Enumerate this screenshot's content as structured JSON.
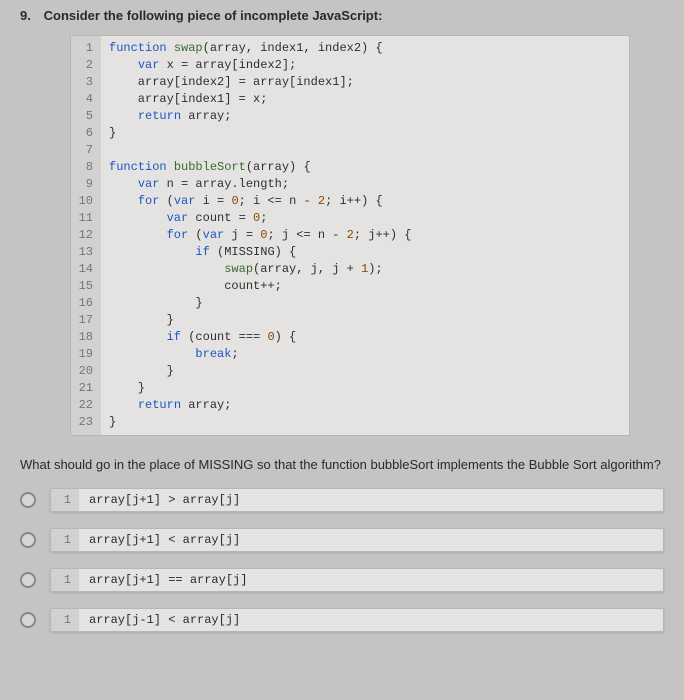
{
  "question": {
    "number": "9.",
    "text": "Consider the following piece of incomplete JavaScript:"
  },
  "code": {
    "lineNumbers": [
      "1",
      "2",
      "3",
      "4",
      "5",
      "6",
      "7",
      "8",
      "9",
      "10",
      "11",
      "12",
      "13",
      "14",
      "15",
      "16",
      "17",
      "18",
      "19",
      "20",
      "21",
      "22",
      "23"
    ],
    "lines": [
      "function swap(array, index1, index2) {",
      "    var x = array[index2];",
      "    array[index2] = array[index1];",
      "    array[index1] = x;",
      "    return array;",
      "}",
      "",
      "function bubbleSort(array) {",
      "    var n = array.length;",
      "    for (var i = 0; i <= n - 2; i++) {",
      "        var count = 0;",
      "        for (var j = 0; j <= n - 2; j++) {",
      "            if (MISSING) {",
      "                swap(array, j, j + 1);",
      "                count++;",
      "            }",
      "        }",
      "        if (count === 0) {",
      "            break;",
      "        }",
      "    }",
      "    return array;",
      "}"
    ]
  },
  "prompt": "What should go in the place of MISSING so that the function bubbleSort implements the Bubble Sort algorithm?",
  "options": [
    {
      "lineNum": "1",
      "code": "array[j+1] > array[j]"
    },
    {
      "lineNum": "1",
      "code": "array[j+1] < array[j]"
    },
    {
      "lineNum": "1",
      "code": "array[j+1] == array[j]"
    },
    {
      "lineNum": "1",
      "code": "array[j-1] < array[j]"
    }
  ]
}
